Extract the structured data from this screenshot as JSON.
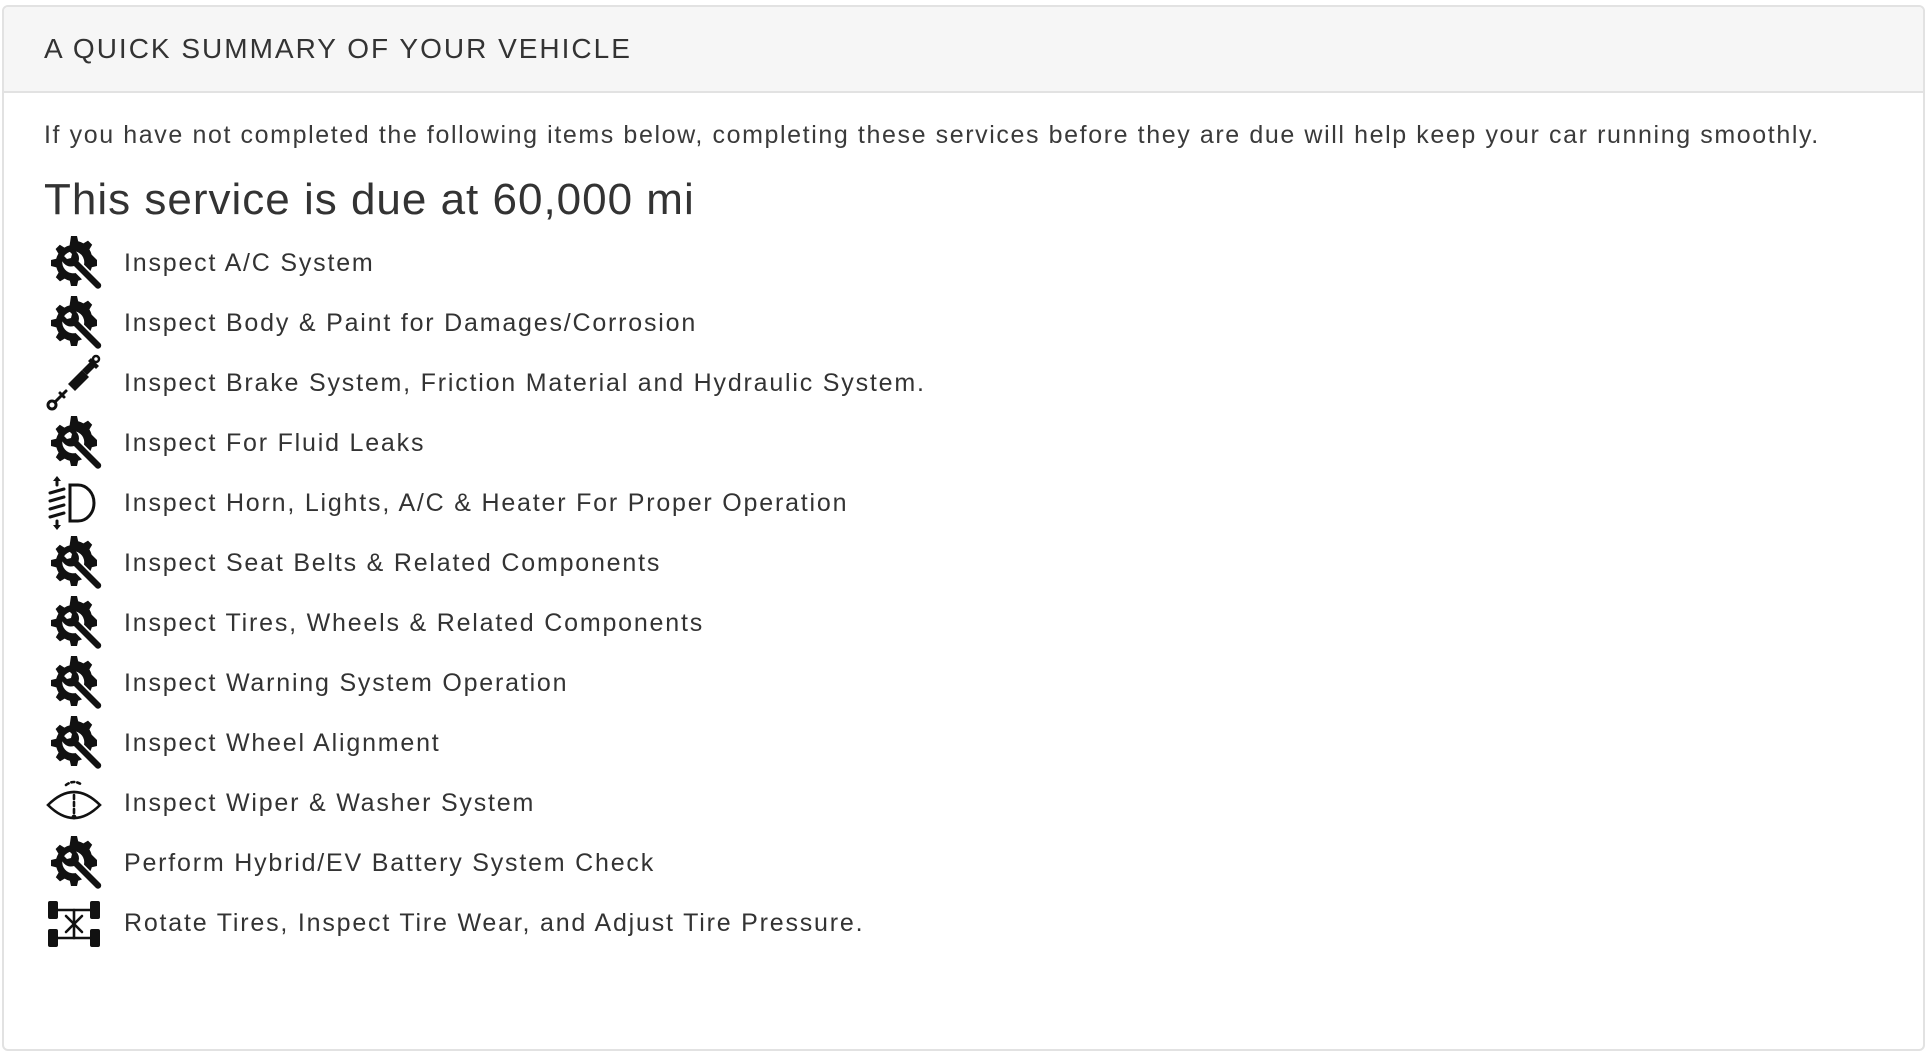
{
  "panel": {
    "title": "A QUICK SUMMARY OF YOUR VEHICLE"
  },
  "intro": {
    "text": "If you have not completed the following items below, completing these services before they are due will help keep your car running smoothly."
  },
  "due": {
    "heading": "This service is due at 60,000 mi"
  },
  "services": [
    {
      "label": "Inspect A/C System",
      "icon": "gear-wrench-icon"
    },
    {
      "label": "Inspect Body & Paint for Damages/Corrosion",
      "icon": "gear-wrench-icon"
    },
    {
      "label": "Inspect Brake System, Friction Material and Hydraulic System.",
      "icon": "brake-shock-icon"
    },
    {
      "label": "Inspect For Fluid Leaks",
      "icon": "gear-wrench-icon"
    },
    {
      "label": "Inspect Horn, Lights, A/C & Heater For Proper Operation",
      "icon": "headlight-icon"
    },
    {
      "label": "Inspect Seat Belts & Related Components",
      "icon": "gear-wrench-icon"
    },
    {
      "label": "Inspect Tires, Wheels & Related Components",
      "icon": "gear-wrench-icon"
    },
    {
      "label": "Inspect Warning System Operation",
      "icon": "gear-wrench-icon"
    },
    {
      "label": "Inspect Wheel Alignment",
      "icon": "gear-wrench-icon"
    },
    {
      "label": "Inspect Wiper & Washer System",
      "icon": "windshield-wiper-icon"
    },
    {
      "label": "Perform Hybrid/EV Battery System Check",
      "icon": "gear-wrench-icon"
    },
    {
      "label": "Rotate Tires, Inspect Tire Wear, and Adjust Tire Pressure.",
      "icon": "tire-rotation-icon"
    }
  ]
}
